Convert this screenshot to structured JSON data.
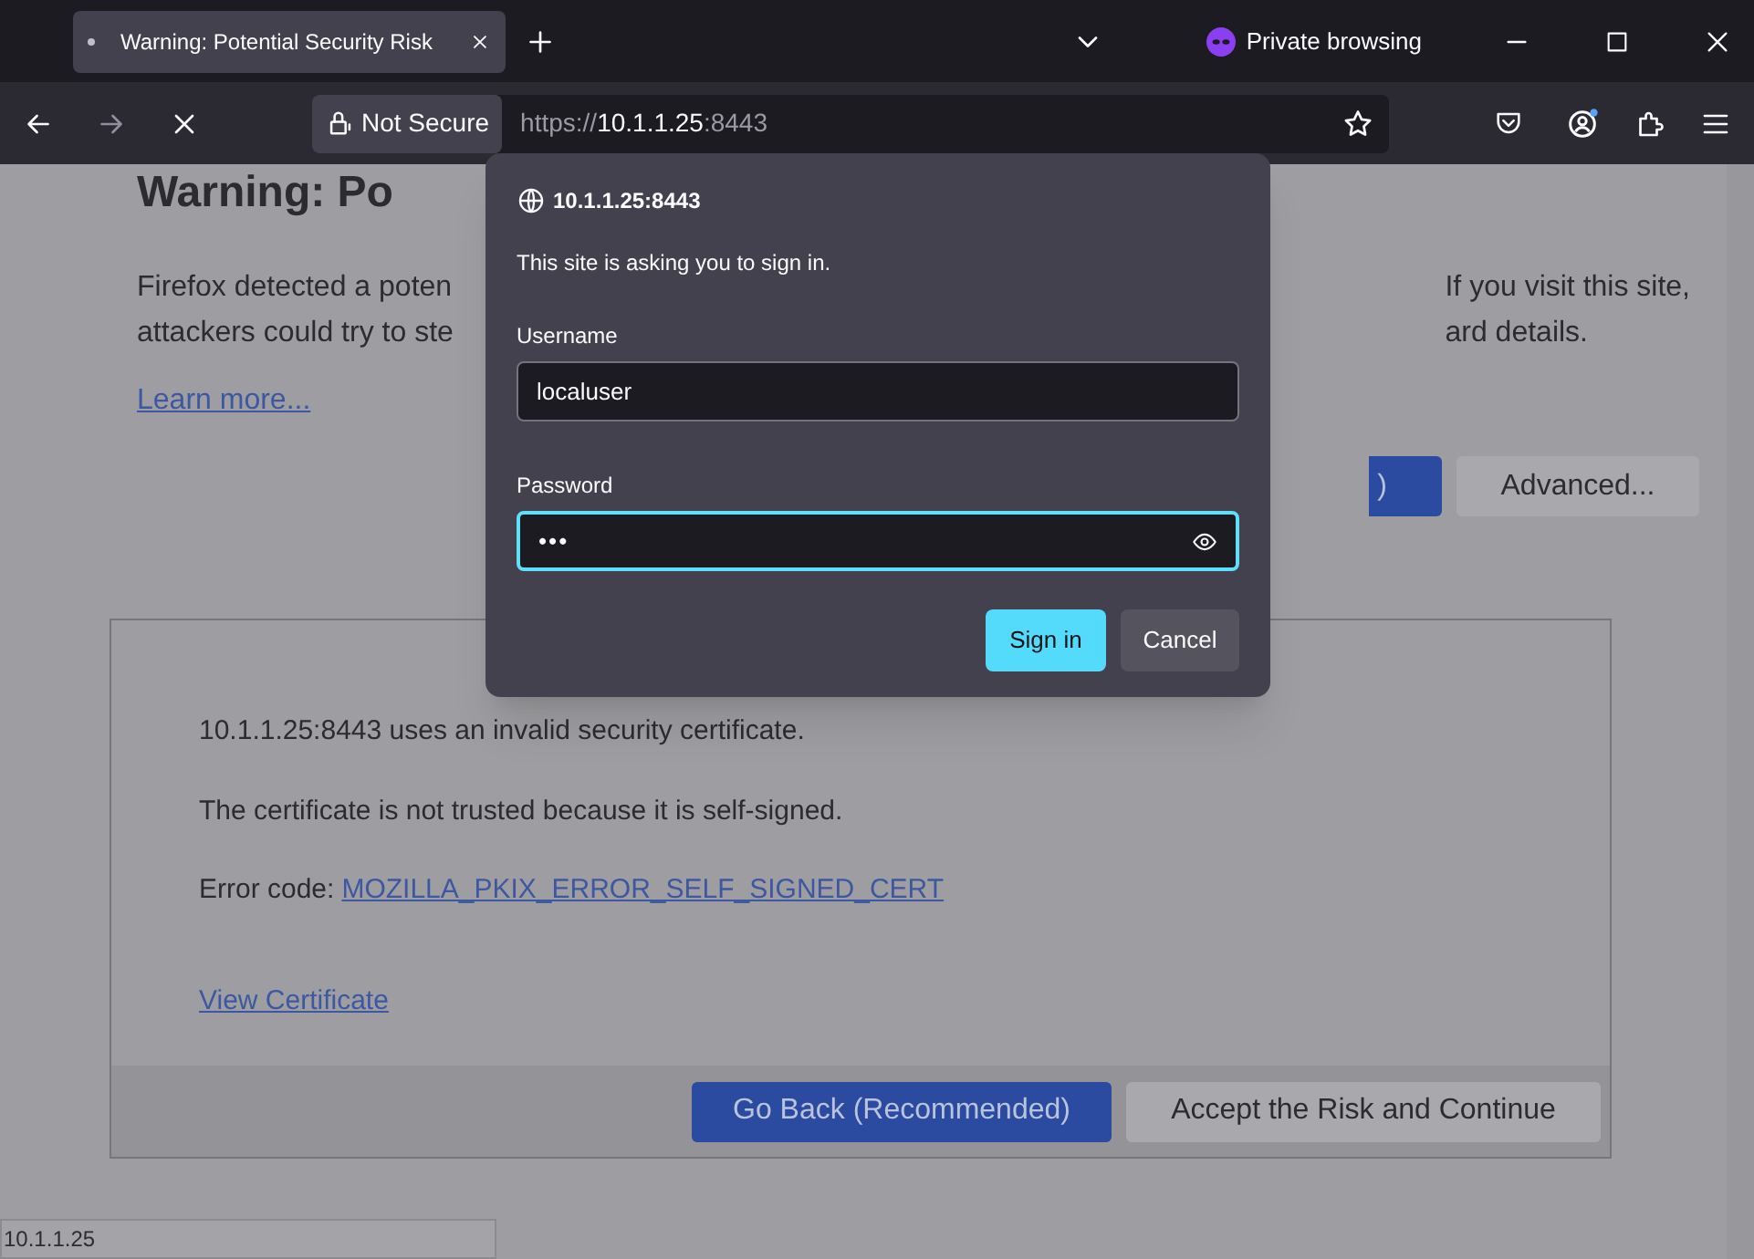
{
  "tabs": [
    {
      "title": "Warning: Potential Security Risk",
      "loading": true,
      "selected": true
    }
  ],
  "private_label": "Private browsing",
  "toolbar": {
    "security_label": "Not Secure",
    "url_scheme": "https://",
    "url_host": "10.1.1.25",
    "url_port": ":8443"
  },
  "page": {
    "heading": "Warning: Po",
    "intro_left": [
      "Firefox detected a poten",
      "attackers could try to ste"
    ],
    "intro_right": [
      "If you visit this site,",
      "ard details."
    ],
    "learn_more": "Learn more...",
    "go_back_sliver": ")",
    "advanced": "Advanced...",
    "details": {
      "lines": [
        "10.1.1.25:8443 uses an invalid security certificate.",
        "The certificate is not trusted because it is self-signed."
      ],
      "error_label": "Error code:",
      "error_code": "MOZILLA_PKIX_ERROR_SELF_SIGNED_CERT",
      "view_certificate": "View Certificate",
      "buttons": [
        {
          "label": "Go Back (Recommended)",
          "kind": "primary"
        },
        {
          "label": "Accept the Risk and Continue",
          "kind": "secondary"
        }
      ]
    }
  },
  "dialog": {
    "origin": "10.1.1.25:8443",
    "message": "This site is asking you to sign in.",
    "fields": [
      {
        "label": "Username",
        "value": "localuser",
        "kind": "text",
        "focused": false
      },
      {
        "label": "Password",
        "value": "•••",
        "kind": "password",
        "focused": true
      }
    ],
    "buttons": [
      {
        "label": "Sign in",
        "kind": "primary"
      },
      {
        "label": "Cancel",
        "kind": "secondary"
      }
    ]
  },
  "status_bar": "10.1.1.25"
}
